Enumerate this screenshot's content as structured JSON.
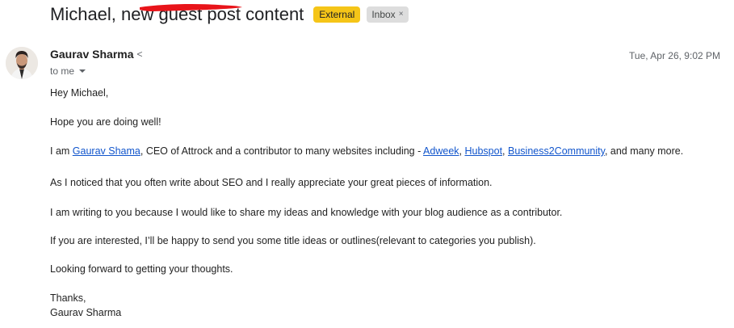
{
  "subject": "Michael, new guest post content",
  "labels": {
    "external": "External",
    "inbox": "Inbox",
    "close": "×"
  },
  "sender": {
    "name": "Gaurav Sharma",
    "email_prefix": "<"
  },
  "timestamp": "Tue, Apr 26, 9:02 PM",
  "recipient": "to me",
  "message": {
    "greeting": "Hey Michael,",
    "line1": "Hope you are doing well!",
    "intro_before": "I am ",
    "intro_link": "Gaurav Shama",
    "intro_mid": ", CEO of Attrock and a contributor to many websites including - ",
    "link_adweek": "Adweek",
    "sep1": ",  ",
    "link_hubspot": "Hubspot",
    "sep2": ", ",
    "link_b2c": "Business2Community",
    "intro_after": ", and many more.",
    "line3": "As I noticed that you often write about SEO and I really appreciate your great pieces of information.",
    "line4": "I am writing to you because I would like to share my ideas and knowledge with your blog audience as a contributor.",
    "line5": "If you are interested, I’ll be happy to send you some title ideas or outlines(relevant to categories you publish).",
    "line6": "Looking forward to getting your thoughts.",
    "signoff": "Thanks,",
    "signature": "Gaurav Sharma"
  },
  "colors": {
    "external_label": "#f5c518",
    "link": "#1155cc",
    "redaction": "#e8141a"
  }
}
